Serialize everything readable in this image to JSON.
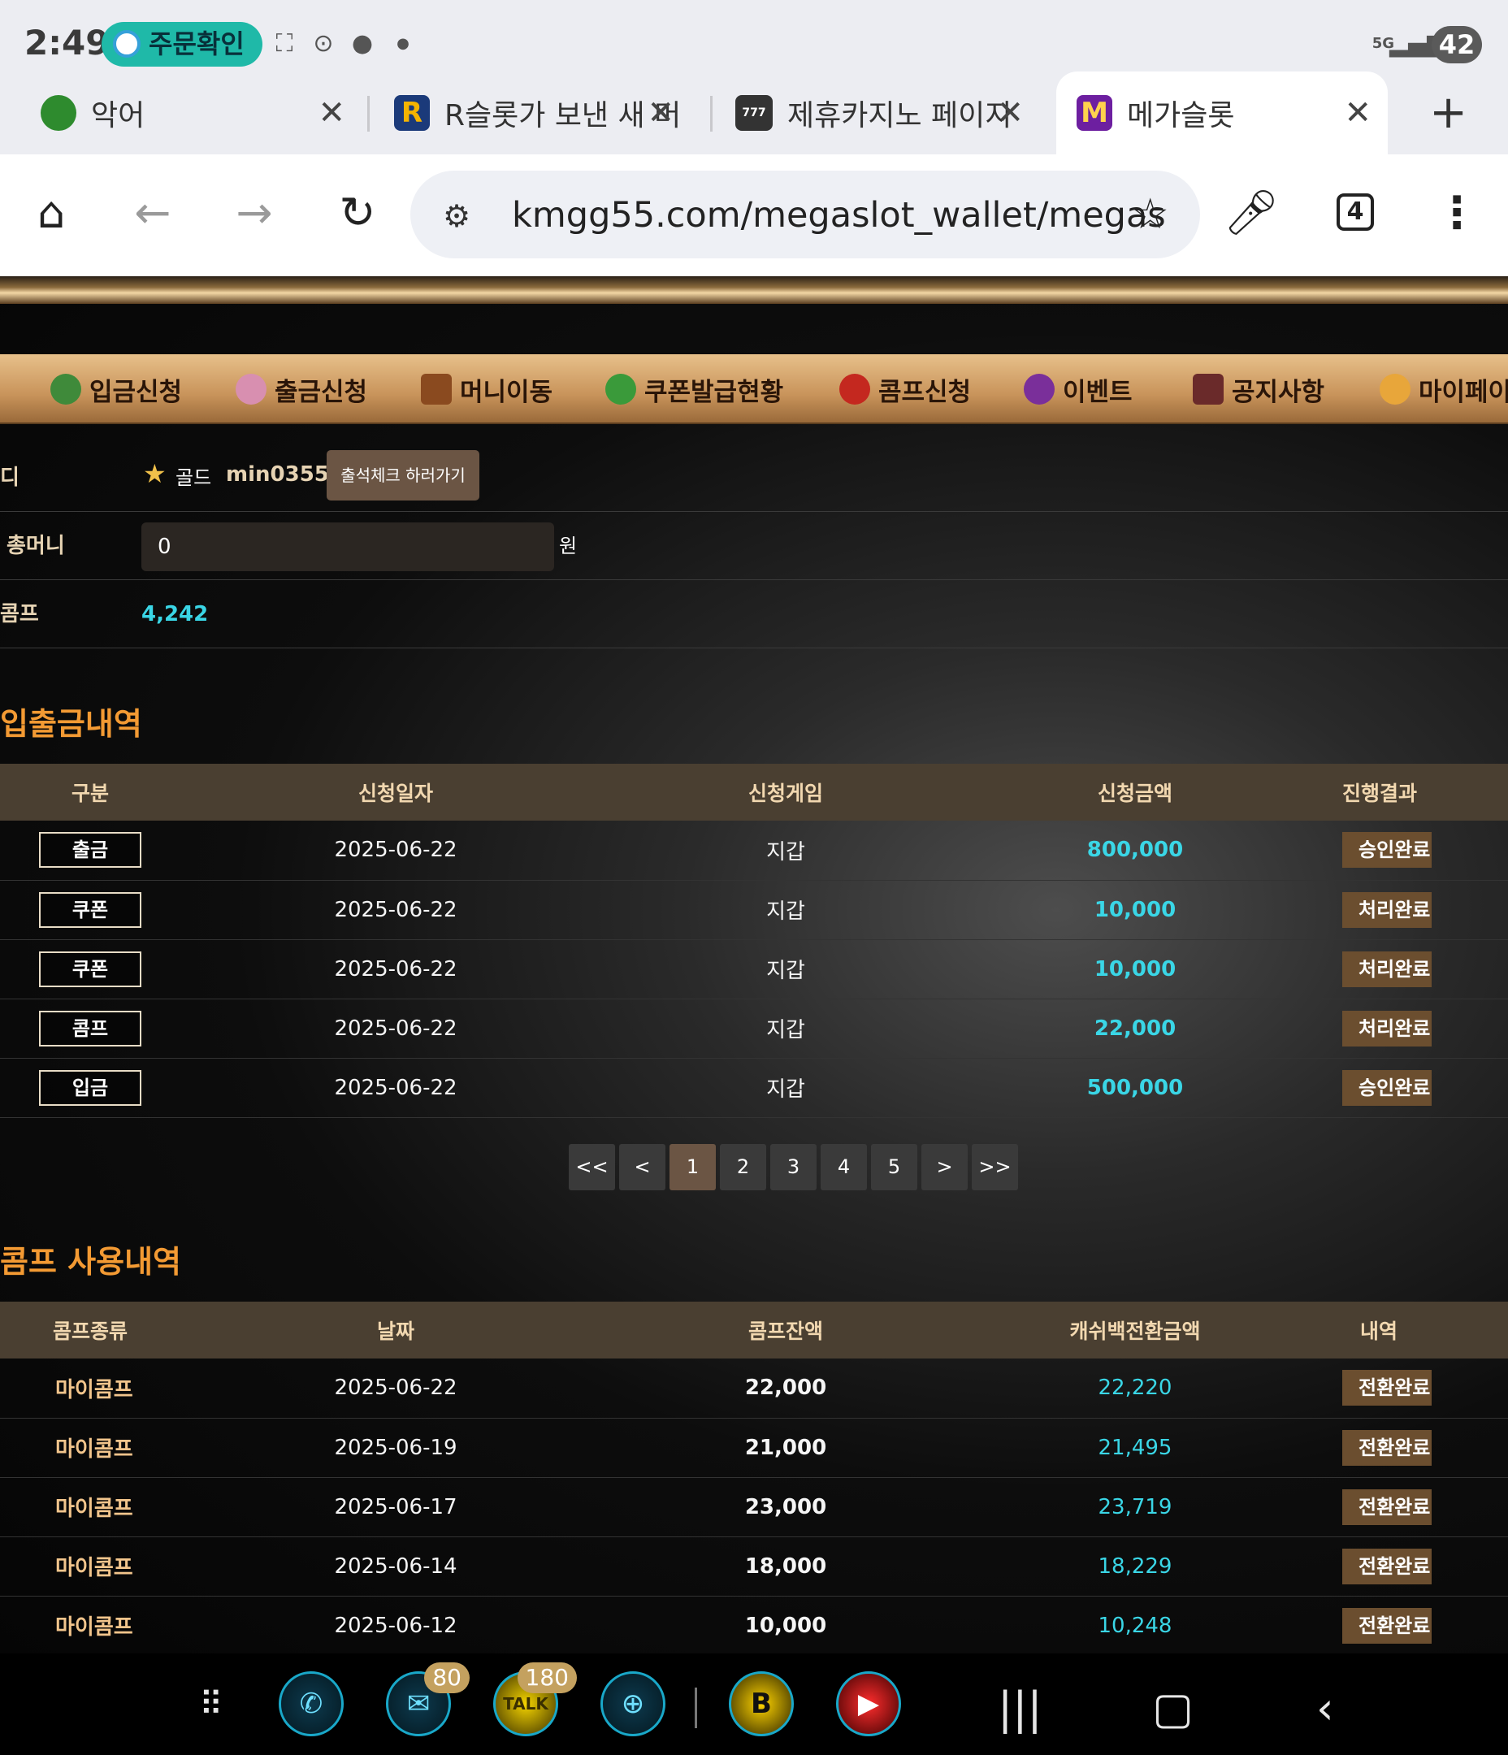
{
  "status_bar": {
    "time": "2:49",
    "notification_pill": "주문확인",
    "network": "5G",
    "battery": "42"
  },
  "tabs": [
    {
      "title": "악어",
      "favicon": "crocodile-icon",
      "active": false
    },
    {
      "title": "R슬롯가 보낸 새 머",
      "favicon": "R",
      "active": false
    },
    {
      "title": "제휴카지노 페이지",
      "favicon": "777",
      "active": false
    },
    {
      "title": "메가슬롯",
      "favicon": "M",
      "active": true
    }
  ],
  "tab_count": "4",
  "address_bar": {
    "url": "kmgg55.com/megaslot_wallet/megas"
  },
  "menu": [
    {
      "label": "입금신청",
      "icon": "money-bag-icon"
    },
    {
      "label": "출금신청",
      "icon": "coin-icon"
    },
    {
      "label": "머니이동",
      "icon": "treasure-chest-icon"
    },
    {
      "label": "쿠폰발급현황",
      "icon": "bonus-icon"
    },
    {
      "label": "콤프신청",
      "icon": "cherry-icon"
    },
    {
      "label": "이벤트",
      "icon": "star-icon"
    },
    {
      "label": "공지사항",
      "icon": "book-icon"
    },
    {
      "label": "마이페이지",
      "icon": "crown-icon"
    }
  ],
  "account": {
    "id_label": "디",
    "grade": "골드",
    "username": "min0355",
    "attendance_button": "출석체크 하러가기",
    "money_label": "총머니",
    "money_value": "0",
    "money_unit": "원",
    "comp_label": "콤프",
    "comp_value": "4,242"
  },
  "transactions": {
    "title": "입출금내역",
    "headers": [
      "구분",
      "신청일자",
      "신청게임",
      "신청금액",
      "진행결과"
    ],
    "rows": [
      {
        "type": "출금",
        "date": "2025-06-22",
        "game": "지갑",
        "amount": "800,000",
        "status": "승인완료"
      },
      {
        "type": "쿠폰",
        "date": "2025-06-22",
        "game": "지갑",
        "amount": "10,000",
        "status": "처리완료"
      },
      {
        "type": "쿠폰",
        "date": "2025-06-22",
        "game": "지갑",
        "amount": "10,000",
        "status": "처리완료"
      },
      {
        "type": "콤프",
        "date": "2025-06-22",
        "game": "지갑",
        "amount": "22,000",
        "status": "처리완료"
      },
      {
        "type": "입금",
        "date": "2025-06-22",
        "game": "지갑",
        "amount": "500,000",
        "status": "승인완료"
      }
    ],
    "pagination": [
      "<<",
      "<",
      "1",
      "2",
      "3",
      "4",
      "5",
      ">",
      ">>"
    ],
    "current_page": "1"
  },
  "comp_history": {
    "title": "콤프 사용내역",
    "headers": [
      "콤프종류",
      "날짜",
      "콤프잔액",
      "캐쉬백전환금액",
      "내역"
    ],
    "rows": [
      {
        "type": "마이콤프",
        "date": "2025-06-22",
        "balance": "22,000",
        "cashback": "22,220",
        "status": "전환완료"
      },
      {
        "type": "마이콤프",
        "date": "2025-06-19",
        "balance": "21,000",
        "cashback": "21,495",
        "status": "전환완료"
      },
      {
        "type": "마이콤프",
        "date": "2025-06-17",
        "balance": "23,000",
        "cashback": "23,719",
        "status": "전환완료"
      },
      {
        "type": "마이콤프",
        "date": "2025-06-14",
        "balance": "18,000",
        "cashback": "18,229",
        "status": "전환완료"
      },
      {
        "type": "마이콤프",
        "date": "2025-06-12",
        "balance": "10,000",
        "cashback": "10,248",
        "status": "전환완료"
      }
    ]
  },
  "nav_bar": {
    "apps": [
      {
        "icon": "apps-grid-icon"
      },
      {
        "icon": "phone-icon"
      },
      {
        "icon": "messages-icon",
        "badge": "80"
      },
      {
        "icon": "kakaotalk-icon",
        "badge": "180"
      },
      {
        "icon": "browser-icon"
      },
      {
        "icon": "b-app-icon"
      },
      {
        "icon": "youtube-icon"
      }
    ]
  }
}
